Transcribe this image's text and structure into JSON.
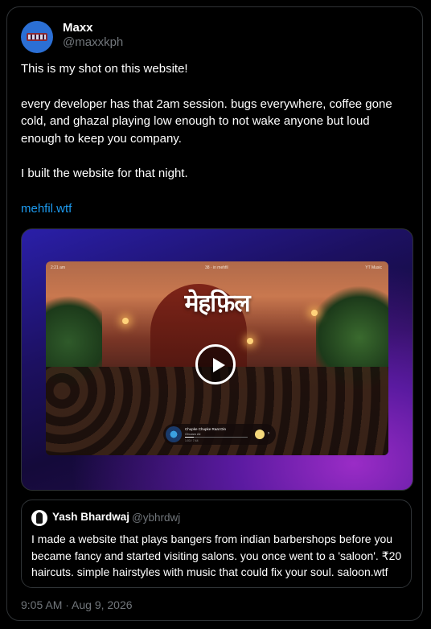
{
  "post": {
    "author_name": "Maxx",
    "author_handle": "@maxxkph",
    "paragraphs": [
      "This is my shot on this website!",
      "every developer has that 2am session. bugs everywhere, coffee gone cold, and ghazal playing low enough to not wake anyone but loud enough to keep you company.",
      "I built the website for that night."
    ],
    "link": "mehfil.wtf",
    "timestamp": "9:05 AM · Aug 9, 2026"
  },
  "media": {
    "site_logo": "मेहफ़िल",
    "topbar_left": "2:21 am",
    "topbar_center": "38 · in mehfil",
    "topbar_right": "YT Music",
    "player": {
      "track_title": "Chupke Chupke Raat Din",
      "track_artist": "Ghulam Ali",
      "track_meta": "1:03 / 7:44",
      "progress": 0.14
    },
    "play_icon": "play-icon"
  },
  "quote": {
    "author_name": "Yash Bhardwaj",
    "author_handle": "@ybhrdwj",
    "text": "I made a website that plays bangers from indian barbershops before you became fancy and started visiting salons. you once went to a 'saloon'. ₹20 haircuts. simple hairstyles with music that could fix your soul. saloon.wtf"
  },
  "colors": {
    "background": "#000000",
    "link": "#1d9bf0",
    "muted": "#71767b",
    "border": "#2f3336"
  }
}
